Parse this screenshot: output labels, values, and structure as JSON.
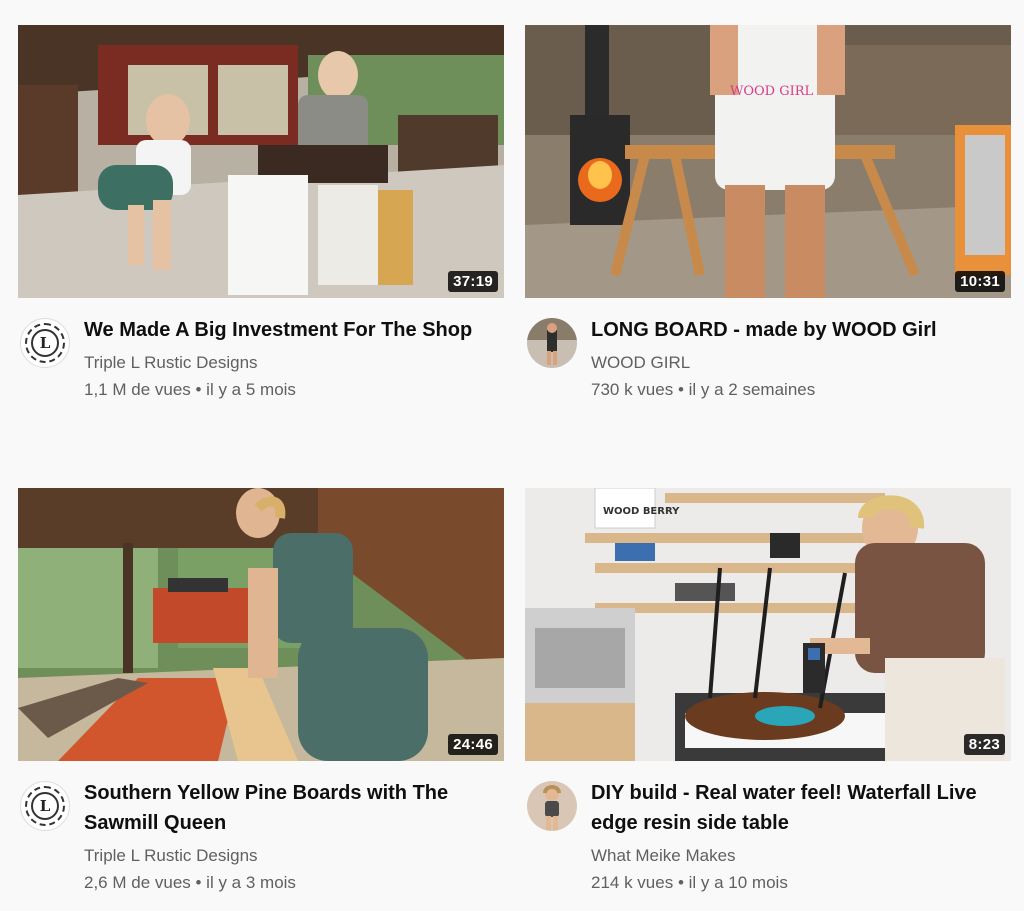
{
  "videos": [
    {
      "title": "We Made A Big Investment For The Shop",
      "channel": "Triple L Rustic Designs",
      "stats": "1,1 M de vues • il y a 5 mois",
      "duration": "37:19",
      "avatar_icon": "triple-l-logo-icon",
      "avatar_letter": "L"
    },
    {
      "title": "LONG BOARD - made by WOOD Girl",
      "channel": "WOOD GIRL",
      "stats": "730 k vues • il y a 2 semaines",
      "duration": "10:31",
      "avatar_icon": "wood-girl-avatar"
    },
    {
      "title": "Southern Yellow Pine Boards with The Sawmill Queen",
      "channel": "Triple L Rustic Designs",
      "stats": "2,6 M de vues • il y a 3 mois",
      "duration": "24:46",
      "avatar_icon": "triple-l-logo-icon",
      "avatar_letter": "L"
    },
    {
      "title": "DIY build - Real water feel! Waterfall Live edge resin side table",
      "channel": "What Meike Makes",
      "stats": "214 k vues • il y a 10 mois",
      "duration": "8:23",
      "avatar_icon": "what-meike-makes-avatar"
    }
  ],
  "thumb_text": {
    "wood_girl_shirt": "WOOD GIRL",
    "wood_berry_sign": "WOOD BERRY"
  }
}
